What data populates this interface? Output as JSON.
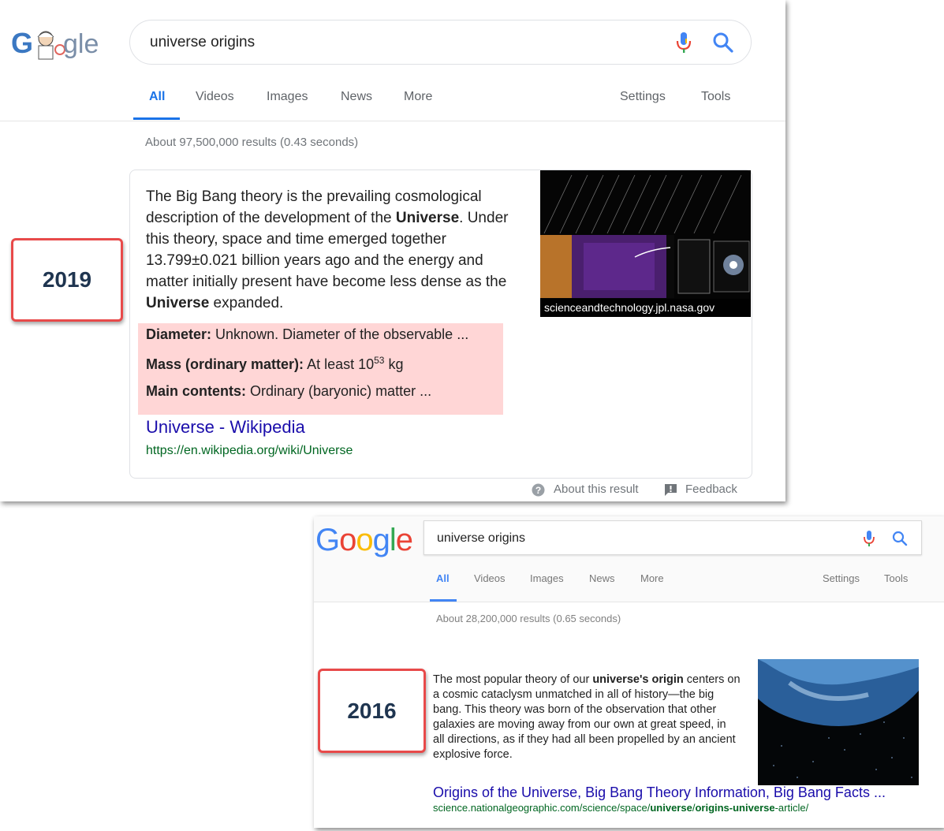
{
  "screenshot_2019": {
    "year_label": "2019",
    "search": {
      "query": "universe origins"
    },
    "tabs": [
      "All",
      "Videos",
      "Images",
      "News",
      "More"
    ],
    "right_tabs": [
      "Settings",
      "Tools"
    ],
    "result_stats": "About 97,500,000 results (0.43 seconds)",
    "snippet": {
      "t1": "The Big Bang theory is the prevailing cosmological description of the development of the ",
      "b1": "Universe",
      "t2": ". Under this theory, space and time emerged together 13.799±0.021 billion years ago and the energy and matter initially present have become less dense as the ",
      "b2": "Universe",
      "t3": " expanded."
    },
    "facts": [
      {
        "label": "Diameter:",
        "value": " Unknown. Diameter of the observable ..."
      },
      {
        "label": "Mass (ordinary matter):",
        "value": " At least 10",
        "sup": "53",
        "suffix": " kg"
      },
      {
        "label": "Main contents:",
        "value": " Ordinary (baryonic) matter ..."
      }
    ],
    "image_caption": "scienceandtechnology.jpl.nasa.gov",
    "link_title": "Universe - Wikipedia",
    "link_url": "https://en.wikipedia.org/wiki/Universe",
    "footer": {
      "about": "About this result",
      "feedback": "Feedback"
    }
  },
  "screenshot_2016": {
    "year_label": "2016",
    "logo": [
      "G",
      "o",
      "o",
      "g",
      "l",
      "e"
    ],
    "logo_colors": [
      "#4285f4",
      "#ea4335",
      "#fbbc05",
      "#4285f4",
      "#34a853",
      "#ea4335"
    ],
    "search": {
      "query": "universe origins"
    },
    "tabs": [
      "All",
      "Videos",
      "Images",
      "News",
      "More"
    ],
    "right_tabs": [
      "Settings",
      "Tools"
    ],
    "result_stats": "About 28,200,000 results (0.65 seconds)",
    "snippet": {
      "t1": "The most popular theory of our ",
      "b1": "universe's origin",
      "t2": " centers on a cosmic cataclysm unmatched in all of history—the big bang. This theory was born of the observation that other galaxies are moving away from our own at great speed, in all directions, as if they had all been propelled by an ancient explosive force."
    },
    "link_title": "Origins of the Universe, Big Bang Theory Information, Big Bang Facts ...",
    "link_url": {
      "p1": "science.nationalgeographic.com/science/space/",
      "b1": "universe",
      "p2": "/",
      "b2": "origins-universe",
      "p3": "-article/"
    }
  },
  "colors": {
    "link_blue": "#1a0dab",
    "url_green": "#006621",
    "active_tab_2019": "#1a73e8",
    "active_tab_2016": "#4285f4",
    "fact_highlight": "#ffd6d6",
    "year_border": "#e84a4a",
    "year_text": "#1f3550"
  }
}
